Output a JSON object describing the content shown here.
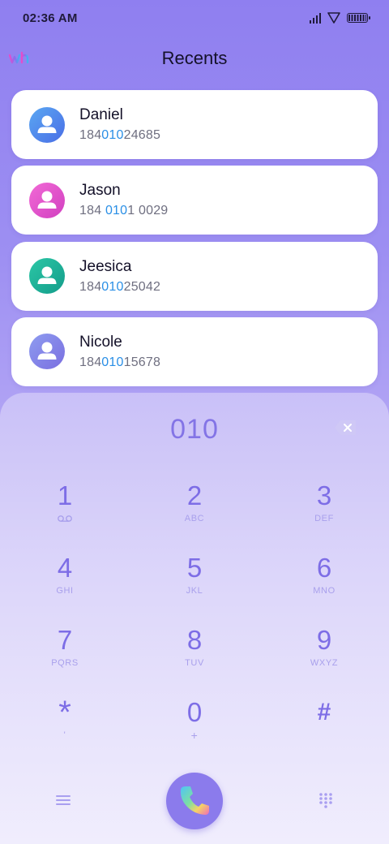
{
  "status_bar": {
    "time": "02:36 AM"
  },
  "header": {
    "title": "Recents"
  },
  "contacts": [
    {
      "name": "Daniel",
      "number_pre": "184",
      "number_match": "010",
      "number_post": "24685",
      "avatar_color": "#4a8fe8"
    },
    {
      "name": "Jason",
      "number_pre": "184 ",
      "number_match": "010",
      "number_post": "1 0029",
      "avatar_color": "#e84bc8"
    },
    {
      "name": "Jeesica",
      "number_pre": "184",
      "number_match": "010",
      "number_post": "25042",
      "avatar_color": "#1fb39a"
    },
    {
      "name": "Nicole",
      "number_pre": "184",
      "number_match": "010",
      "number_post": "15678",
      "avatar_color": "#7f86e6"
    }
  ],
  "dialer": {
    "input_value": "010",
    "keys": [
      {
        "digit": "1",
        "letters": ""
      },
      {
        "digit": "2",
        "letters": "ABC"
      },
      {
        "digit": "3",
        "letters": "DEF"
      },
      {
        "digit": "4",
        "letters": "GHI"
      },
      {
        "digit": "5",
        "letters": "JKL"
      },
      {
        "digit": "6",
        "letters": "MNO"
      },
      {
        "digit": "7",
        "letters": "PQRS"
      },
      {
        "digit": "8",
        "letters": "TUV"
      },
      {
        "digit": "9",
        "letters": "WXYZ"
      },
      {
        "digit": "*",
        "letters": "'"
      },
      {
        "digit": "0",
        "letters": "+"
      },
      {
        "digit": "#",
        "letters": ""
      }
    ]
  },
  "icons": {
    "voicemail": "voicemail-icon",
    "backspace": "backspace-icon",
    "menu": "menu-icon",
    "call": "phone-icon",
    "dialpad": "dialpad-grid-icon"
  },
  "colors": {
    "accent": "#8374e6",
    "highlight": "#2a8fe6",
    "call_button": "#8b7bec"
  }
}
